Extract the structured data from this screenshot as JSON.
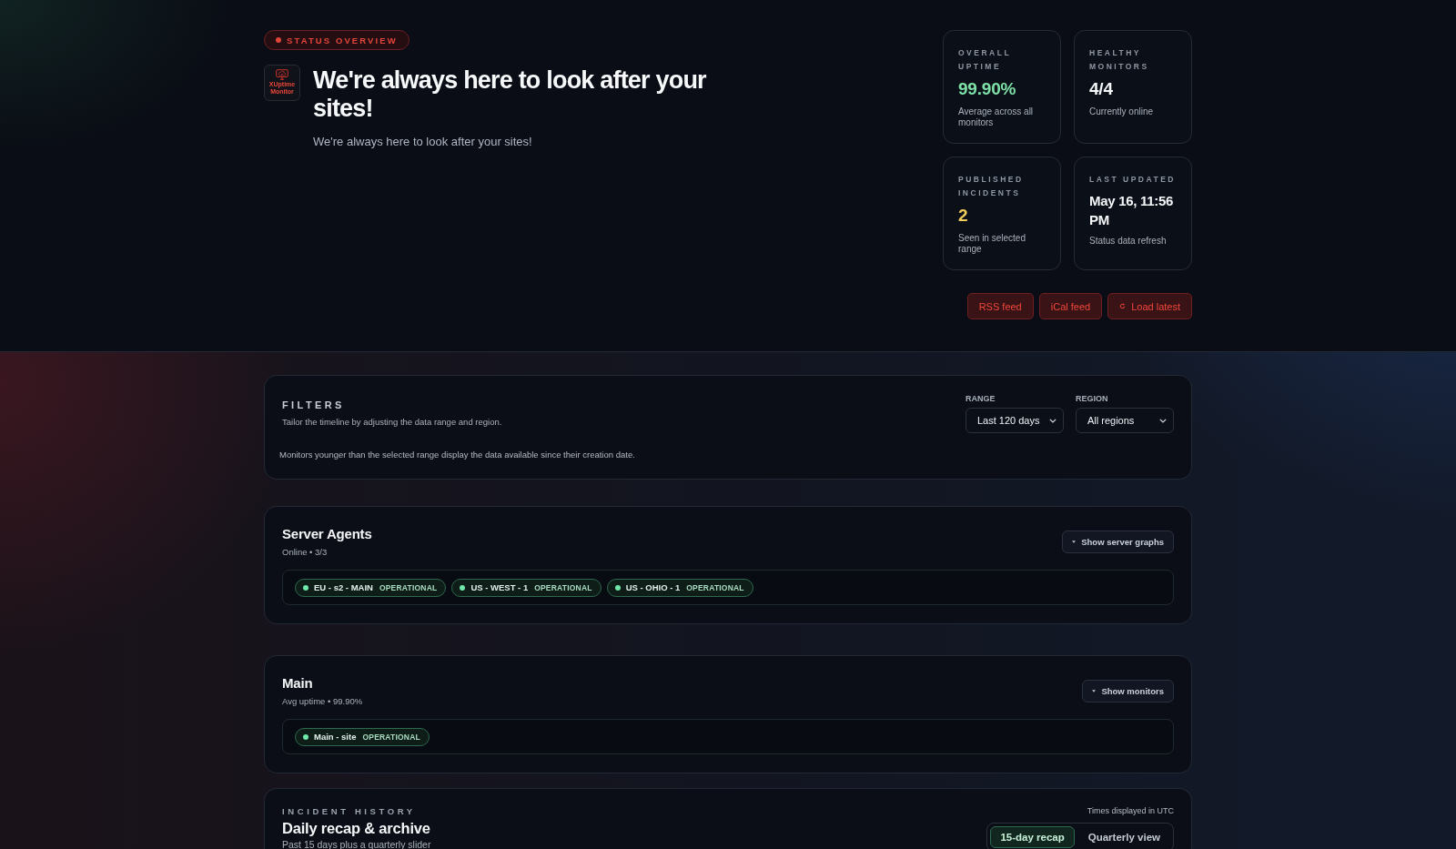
{
  "hero": {
    "badge": "STATUS OVERVIEW",
    "logo_text": "XUptime Monitor",
    "title": "We're always here to look after your sites!",
    "subtitle": "We're always here to look after your sites!"
  },
  "stats": [
    {
      "label": "OVERALL UPTIME",
      "value": "99.90%",
      "note": "Average across all monitors",
      "color": "#7ee2a8",
      "kind": "metric"
    },
    {
      "label": "HEALTHY MONITORS",
      "value": "4/4",
      "note": "Currently online",
      "color": "#f4f6f8",
      "kind": "metric"
    },
    {
      "label": "PUBLISHED INCIDENTS",
      "value": "2",
      "note": "Seen in selected range",
      "color": "#f2cd5c",
      "kind": "metric"
    },
    {
      "label": "LAST UPDATED",
      "value": "May 16, 11:56 PM",
      "note": "Status data refresh",
      "color": "#f4f6f8",
      "kind": "timestamp"
    }
  ],
  "actions": [
    {
      "label": "RSS feed",
      "kind": "feed"
    },
    {
      "label": "iCal feed",
      "kind": "feed"
    },
    {
      "label": "Load latest",
      "kind": "refresh"
    }
  ],
  "filters": {
    "title": "FILTERS",
    "description": "Tailor the timeline by adjusting the data range and region.",
    "note": "Monitors younger than the selected range display the data available since their creation date.",
    "selects": [
      {
        "label": "RANGE",
        "value": "Last 120 days"
      },
      {
        "label": "REGION",
        "value": "All regions"
      }
    ]
  },
  "groups": [
    {
      "title": "Server Agents",
      "meta": "Online • 3/3",
      "toggle": "Show server graphs",
      "items": [
        {
          "name": "EU - s2 - MAIN",
          "status": "OPERATIONAL",
          "color": "#6ee7a8"
        },
        {
          "name": "US - WEST - 1",
          "status": "OPERATIONAL",
          "color": "#6ee7a8"
        },
        {
          "name": "US - OHIO - 1",
          "status": "OPERATIONAL",
          "color": "#6ee7a8"
        }
      ]
    },
    {
      "title": "Main",
      "meta": "Avg uptime • 99.90%",
      "toggle": "Show monitors",
      "items": [
        {
          "name": "Main - site",
          "status": "OPERATIONAL",
          "color": "#6ee7a8"
        }
      ]
    }
  ],
  "incident": {
    "eyebrow": "INCIDENT HISTORY",
    "title": "Daily recap & archive",
    "subtitle": "Past 15 days plus a quarterly slider",
    "timezone_note": "Times displayed in UTC",
    "tabs": [
      {
        "label": "15-day recap",
        "selected": true
      },
      {
        "label": "Quarterly view",
        "selected": false
      }
    ]
  }
}
